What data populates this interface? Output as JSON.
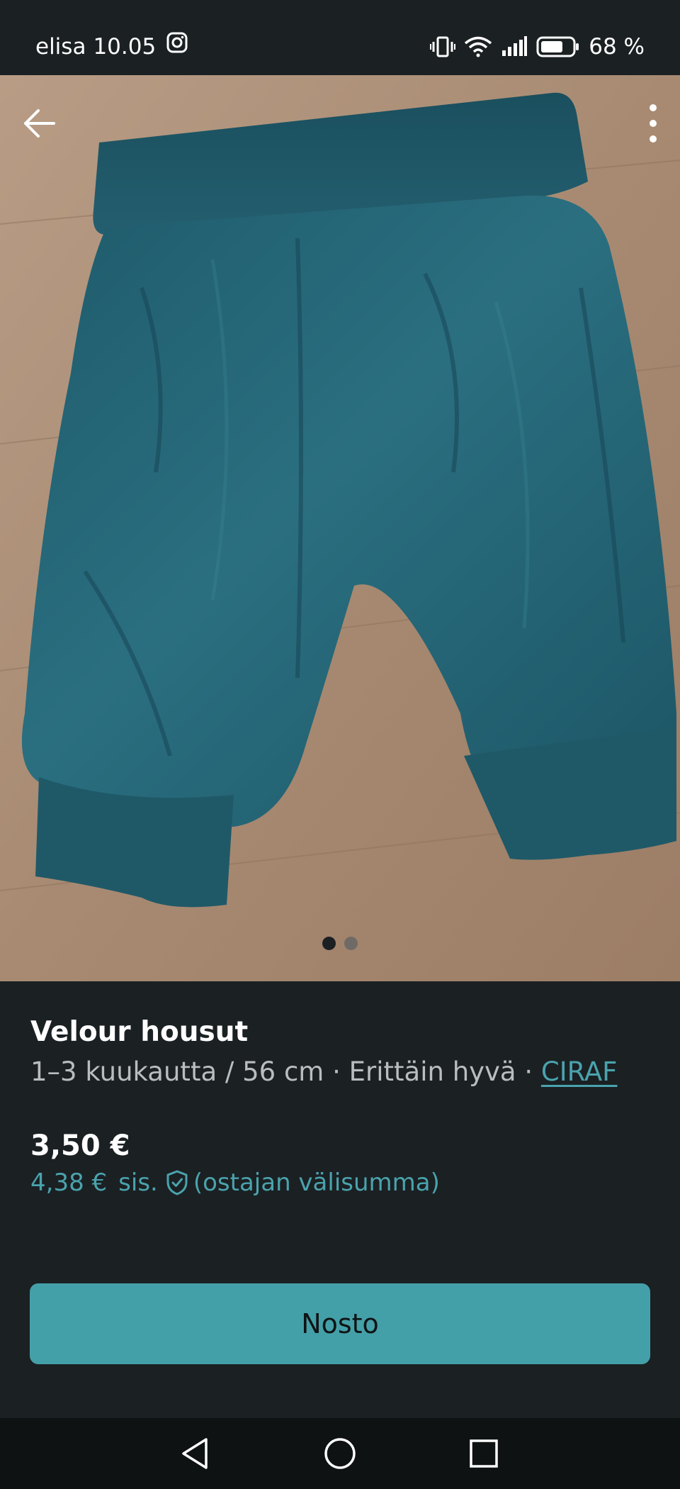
{
  "status_bar": {
    "carrier": "elisa",
    "time": "10.05",
    "battery": "68 %",
    "icons": [
      "instagram-icon",
      "vibrate-icon",
      "wifi-icon",
      "signal-icon",
      "battery-icon"
    ]
  },
  "gallery": {
    "image_count": 2,
    "current_index": 0,
    "subject": "teal velour baby pants on wooden floor"
  },
  "toolbar": {
    "back_icon": "arrow-left-icon",
    "more_icon": "more-vertical-icon"
  },
  "item": {
    "title": "Velour housut",
    "size": "1–3 kuukautta / 56 cm",
    "separator": " · ",
    "condition": "Erittäin hyvä",
    "brand": "CIRAF"
  },
  "pricing": {
    "price": "3,50 €",
    "total_price": "4,38 €",
    "total_incl": "sis.",
    "total_note": "(ostajan välisumma)",
    "shield_icon": "shield-check-icon"
  },
  "actions": {
    "buy_label": "Nosto"
  },
  "nav": {
    "icons": [
      "back-triangle-icon",
      "home-circle-icon",
      "recents-square-icon"
    ]
  },
  "colors": {
    "background": "#1b2023",
    "accent": "#44a0a8",
    "link": "#4aa3ad",
    "muted_text": "#b9bdbf",
    "nav_bar": "#0f1213"
  }
}
